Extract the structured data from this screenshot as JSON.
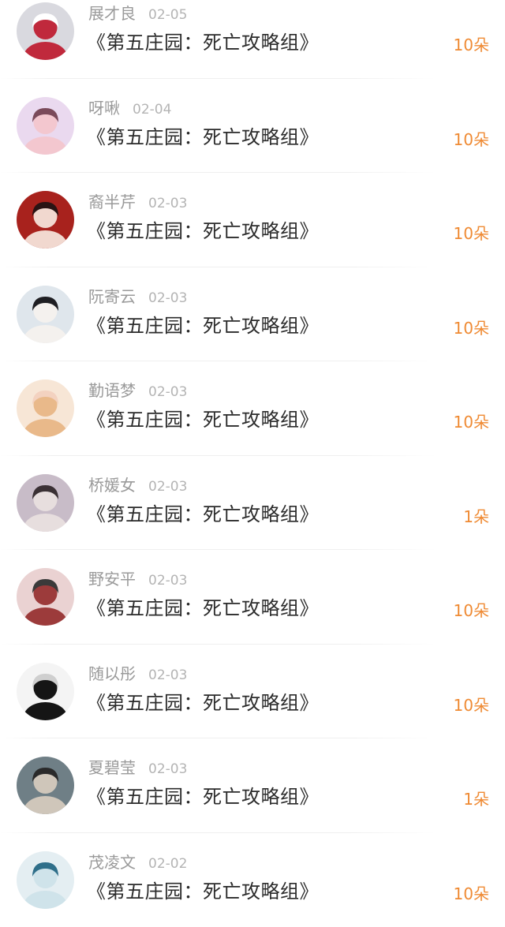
{
  "records": [
    {
      "name": "展才良",
      "date": "02-05",
      "work": "《第五庄园：死亡攻略组》",
      "flowers": "10朵",
      "avatar": {
        "icon": "avatar-red-cake-icon",
        "bg": "#d9d9df",
        "fg": "#c0293c",
        "accent": "#ffffff"
      }
    },
    {
      "name": "呀啾",
      "date": "02-04",
      "work": "《第五庄园：死亡攻略组》",
      "flowers": "10朵",
      "avatar": {
        "icon": "avatar-pastel-girl-icon",
        "bg": "#ead9ef",
        "fg": "#f3c7cf",
        "accent": "#7a4a5a"
      }
    },
    {
      "name": "裔半芹",
      "date": "02-03",
      "work": "《第五庄园：死亡攻略组》",
      "flowers": "10朵",
      "avatar": {
        "icon": "avatar-girl-red-background-icon",
        "bg": "#a8221d",
        "fg": "#f1d8cf",
        "accent": "#2a1414"
      }
    },
    {
      "name": "阮寄云",
      "date": "02-03",
      "work": "《第五庄园：死亡攻略组》",
      "flowers": "10朵",
      "avatar": {
        "icon": "avatar-girl-white-shirt-icon",
        "bg": "#dfe6ec",
        "fg": "#f4f1ee",
        "accent": "#1e1e22"
      }
    },
    {
      "name": "勤语梦",
      "date": "02-03",
      "work": "《第五庄园：死亡攻略组》",
      "flowers": "10朵",
      "avatar": {
        "icon": "avatar-anime-girl-golden-icon",
        "bg": "#f7e6d6",
        "fg": "#e9b98a",
        "accent": "#f3d2c0"
      }
    },
    {
      "name": "桥媛女",
      "date": "02-03",
      "work": "《第五庄园：死亡攻略组》",
      "flowers": "1朵",
      "avatar": {
        "icon": "avatar-girl-muted-purple-icon",
        "bg": "#c8bcc8",
        "fg": "#e7dede",
        "accent": "#3a3034"
      }
    },
    {
      "name": "野安平",
      "date": "02-03",
      "work": "《第五庄园：死亡攻略组》",
      "flowers": "10朵",
      "avatar": {
        "icon": "avatar-chibi-glasses-horns-icon",
        "bg": "#ead2d2",
        "fg": "#9c3b3b",
        "accent": "#3a3a3a"
      }
    },
    {
      "name": "随以彤",
      "date": "02-03",
      "work": "《第五庄园：死亡攻略组》",
      "flowers": "10朵",
      "avatar": {
        "icon": "avatar-black-suit-figure-icon",
        "bg": "#f4f4f4",
        "fg": "#151515",
        "accent": "#cfcfcf"
      }
    },
    {
      "name": "夏碧莹",
      "date": "02-03",
      "work": "《第五庄园：死亡攻略组》",
      "flowers": "1朵",
      "avatar": {
        "icon": "avatar-boy-grey-sweater-icon",
        "bg": "#6f7f86",
        "fg": "#cfc6ba",
        "accent": "#2a2a2a"
      }
    },
    {
      "name": "茂凌文",
      "date": "02-02",
      "work": "《第五庄园：死亡攻略组》",
      "flowers": "10朵",
      "avatar": {
        "icon": "avatar-anime-silver-hair-icon",
        "bg": "#e4eef2",
        "fg": "#cfe3ea",
        "accent": "#2f6f8a"
      }
    }
  ]
}
